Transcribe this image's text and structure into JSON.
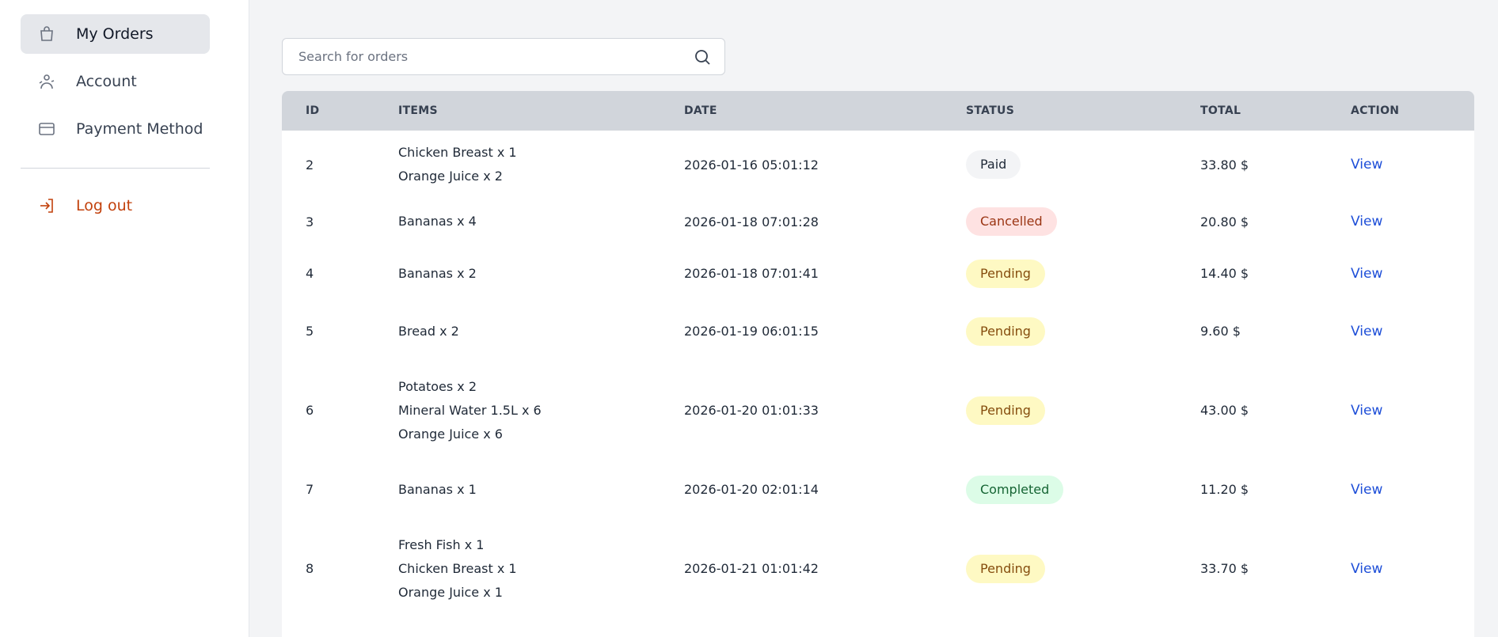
{
  "sidebar": {
    "items": [
      {
        "label": "My Orders",
        "icon": "shopping-bag-icon",
        "active": true
      },
      {
        "label": "Account",
        "icon": "user-icon",
        "active": false
      },
      {
        "label": "Payment Method",
        "icon": "credit-card-icon",
        "active": false
      }
    ],
    "logout_label": "Log out"
  },
  "search": {
    "placeholder": "Search for orders",
    "value": ""
  },
  "table": {
    "headers": {
      "id": "ID",
      "items": "ITEMS",
      "date": "DATE",
      "status": "STATUS",
      "total": "TOTAL",
      "action": "ACTION"
    },
    "rows": [
      {
        "id": "2",
        "items": [
          "Chicken Breast x 1",
          "Orange Juice x 2"
        ],
        "date": "2026-01-16 05:01:12",
        "status": "Paid",
        "status_kind": "paid",
        "total": "33.80 $",
        "action": "View"
      },
      {
        "id": "3",
        "items": [
          "Bananas x 4"
        ],
        "date": "2026-01-18 07:01:28",
        "status": "Cancelled",
        "status_kind": "cancelled",
        "total": "20.80 $",
        "action": "View"
      },
      {
        "id": "4",
        "items": [
          "Bananas x 2"
        ],
        "date": "2026-01-18 07:01:41",
        "status": "Pending",
        "status_kind": "pending",
        "total": "14.40 $",
        "action": "View"
      },
      {
        "id": "5",
        "items": [
          "Bread x 2"
        ],
        "date": "2026-01-19 06:01:15",
        "status": "Pending",
        "status_kind": "pending",
        "total": "9.60 $",
        "action": "View"
      },
      {
        "id": "6",
        "items": [
          "Potatoes x 2",
          "Mineral Water 1.5L x 6",
          "Orange Juice x 6"
        ],
        "date": "2026-01-20 01:01:33",
        "status": "Pending",
        "status_kind": "pending",
        "total": "43.00 $",
        "action": "View"
      },
      {
        "id": "7",
        "items": [
          "Bananas x 1"
        ],
        "date": "2026-01-20 02:01:14",
        "status": "Completed",
        "status_kind": "completed",
        "total": "11.20 $",
        "action": "View"
      },
      {
        "id": "8",
        "items": [
          "Fresh Fish x 1",
          "Chicken Breast x 1",
          "Orange Juice x 1"
        ],
        "date": "2026-01-21 01:01:42",
        "status": "Pending",
        "status_kind": "pending",
        "total": "33.70 $",
        "action": "View"
      }
    ]
  },
  "colors": {
    "accent_link": "#1d4ed8",
    "logout": "#c2410c",
    "header_bg": "#d1d5db"
  }
}
